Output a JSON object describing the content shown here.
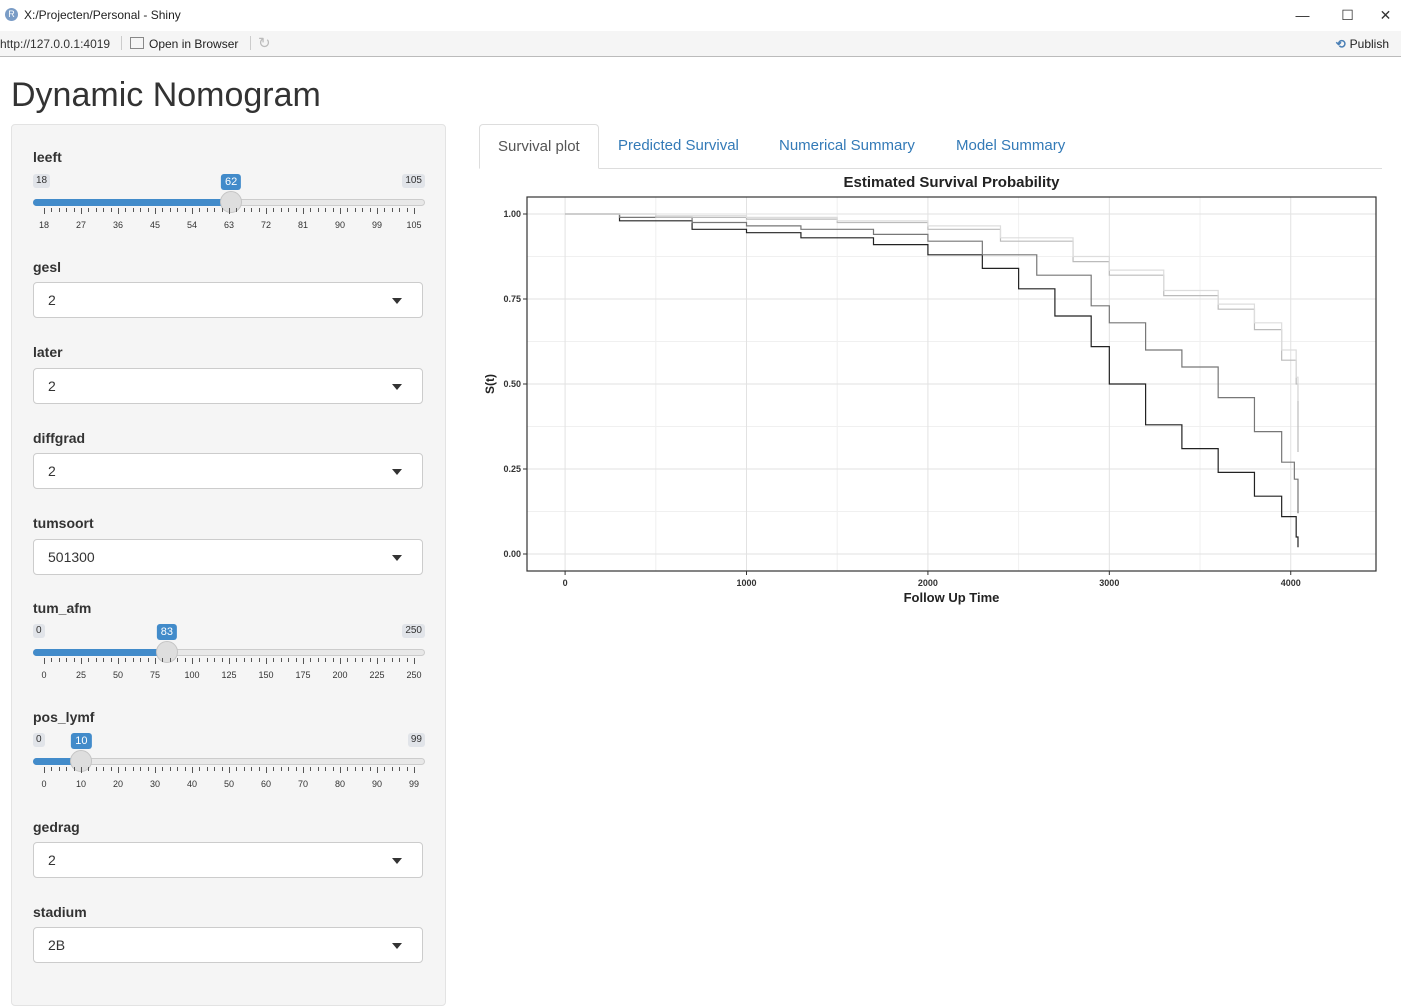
{
  "window": {
    "title": "X:/Projecten/Personal - Shiny",
    "minimize": "—",
    "maximize": "☐",
    "close": "✕"
  },
  "toolbar": {
    "url": "http://127.0.0.1:4019",
    "open_in_browser": "Open in Browser",
    "publish": "Publish"
  },
  "app": {
    "title": "Dynamic Nomogram"
  },
  "sidebar": {
    "leeft": {
      "label": "leeft",
      "min": 18,
      "max": 105,
      "value": 62,
      "ticks": [
        "18",
        "27",
        "36",
        "45",
        "54",
        "63",
        "72",
        "81",
        "90",
        "99",
        "105"
      ]
    },
    "gesl": {
      "label": "gesl",
      "value": "2"
    },
    "later": {
      "label": "later",
      "value": "2"
    },
    "diffgrad": {
      "label": "diffgrad",
      "value": "2"
    },
    "tumsoort": {
      "label": "tumsoort",
      "value": "501300"
    },
    "tum_afm": {
      "label": "tum_afm",
      "min": 0,
      "max": 250,
      "value": 83,
      "ticks": [
        "0",
        "25",
        "50",
        "75",
        "100",
        "125",
        "150",
        "175",
        "200",
        "225",
        "250"
      ]
    },
    "pos_lymf": {
      "label": "pos_lymf",
      "min": 0,
      "max": 99,
      "value": 10,
      "ticks": [
        "0",
        "10",
        "20",
        "30",
        "40",
        "50",
        "60",
        "70",
        "80",
        "90",
        "99"
      ]
    },
    "gedrag": {
      "label": "gedrag",
      "value": "2"
    },
    "stadium": {
      "label": "stadium",
      "value": "2B"
    }
  },
  "tabs": [
    "Survival plot",
    "Predicted Survival",
    "Numerical Summary",
    "Model Summary"
  ],
  "active_tab": 0,
  "chart_data": {
    "type": "line",
    "title": "Estimated Survival Probability",
    "xlabel": "Follow Up Time",
    "ylabel": "S(t)",
    "xlim": [
      -210,
      4470
    ],
    "ylim": [
      -0.05,
      1.05
    ],
    "xticks": [
      0,
      1000,
      2000,
      3000,
      4000
    ],
    "yticks": [
      0.0,
      0.25,
      0.5,
      0.75,
      1.0
    ],
    "ytick_labels": [
      "0.00",
      "0.25",
      "0.50",
      "0.75",
      "1.00"
    ],
    "grid": true,
    "legend": "none",
    "series": [
      {
        "color": "#222222",
        "x": [
          0,
          300,
          700,
          1000,
          1300,
          1700,
          2000,
          2300,
          2500,
          2700,
          2900,
          3000,
          3200,
          3400,
          3600,
          3800,
          3950,
          4030,
          4040
        ],
        "y": [
          1.0,
          0.98,
          0.955,
          0.945,
          0.93,
          0.91,
          0.88,
          0.84,
          0.78,
          0.7,
          0.61,
          0.5,
          0.38,
          0.31,
          0.24,
          0.17,
          0.11,
          0.05,
          0.02
        ]
      },
      {
        "color": "#777777",
        "x": [
          0,
          300,
          700,
          1000,
          1300,
          1700,
          2000,
          2300,
          2600,
          2900,
          3000,
          3200,
          3400,
          3600,
          3800,
          3950,
          4020,
          4040
        ],
        "y": [
          1.0,
          0.99,
          0.975,
          0.965,
          0.955,
          0.94,
          0.92,
          0.88,
          0.82,
          0.73,
          0.68,
          0.6,
          0.55,
          0.46,
          0.36,
          0.27,
          0.22,
          0.12
        ]
      },
      {
        "color": "#bbbbbb",
        "x": [
          0,
          500,
          1000,
          1500,
          2000,
          2400,
          2800,
          3000,
          3300,
          3600,
          3800,
          3950,
          4030,
          4040
        ],
        "y": [
          1.0,
          0.99,
          0.985,
          0.975,
          0.955,
          0.92,
          0.86,
          0.82,
          0.76,
          0.72,
          0.66,
          0.57,
          0.5,
          0.3
        ]
      },
      {
        "color": "#dddddd",
        "x": [
          0,
          500,
          1000,
          1500,
          2000,
          2400,
          2800,
          3000,
          3300,
          3600,
          3800,
          3950,
          4030,
          4040
        ],
        "y": [
          1.0,
          0.995,
          0.99,
          0.98,
          0.965,
          0.93,
          0.875,
          0.835,
          0.775,
          0.735,
          0.68,
          0.6,
          0.52,
          0.45
        ]
      }
    ]
  }
}
